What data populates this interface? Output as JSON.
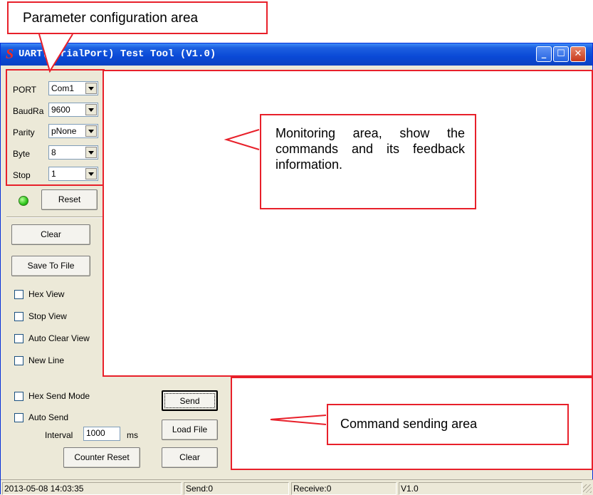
{
  "annotations": {
    "parameter_area": "Parameter configuration area",
    "monitoring_area": "Monitoring  area,  show the  commands  and  its feedback information.",
    "command_area": "Command sending area"
  },
  "window": {
    "title": "UART(SerialPort) Test Tool (V1.0)",
    "accent_color": "#0a49d6"
  },
  "params": {
    "port_label": "PORT",
    "port_value": "Com1",
    "baud_label": "BaudRa",
    "baud_value": "9600",
    "parity_label": "Parity",
    "parity_value": "pNone",
    "byte_label": "Byte",
    "byte_value": "8",
    "stop_label": "Stop",
    "stop_value": "1"
  },
  "controls": {
    "reset_label": "Reset",
    "clear_label": "Clear",
    "save_label": "Save To File",
    "hex_view": "Hex View",
    "stop_view": "Stop View",
    "auto_clear_view": "Auto Clear View",
    "new_line": "New Line",
    "status_led_color": "#2ec61b"
  },
  "send": {
    "hex_send_mode": "Hex Send Mode",
    "auto_send": "Auto Send",
    "interval_label": "Interval",
    "interval_value": "1000",
    "interval_unit": "ms",
    "counter_reset": "Counter Reset",
    "send_label": "Send",
    "load_file_label": "Load File",
    "clear_label": "Clear"
  },
  "status": {
    "datetime": "2013-05-08 14:03:35",
    "send": "Send:0",
    "receive": "Receive:0",
    "version": "V1.0"
  }
}
